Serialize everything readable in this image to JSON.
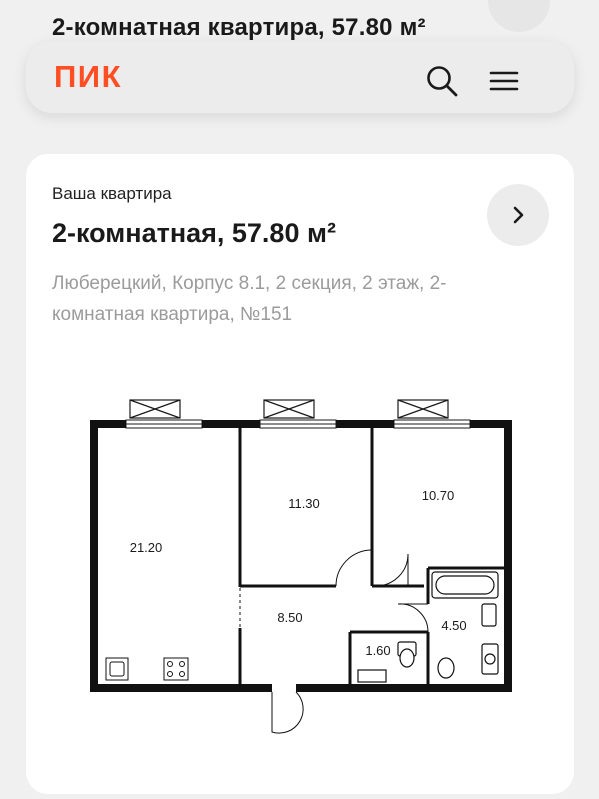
{
  "behind": {
    "title": "2-комнатная квартира, 57.80 м²"
  },
  "header": {
    "logo": "ПИК",
    "brand_color": "#ff4e23",
    "search_icon": "search-icon",
    "menu_icon": "hamburger-menu-icon"
  },
  "card": {
    "label": "Ваша квартира",
    "title": "2-комнатная, 57.80 м²",
    "address": "Люберецкий, Корпус 8.1, 2 секция, 2 этаж, 2-комнатная квартира, №151",
    "arrow_icon": "chevron-right-icon"
  },
  "floorplan": {
    "rooms": [
      {
        "id": "room-1",
        "area": "21.20"
      },
      {
        "id": "room-2",
        "area": "11.30"
      },
      {
        "id": "room-3",
        "area": "10.70"
      },
      {
        "id": "hall",
        "area": "8.50"
      },
      {
        "id": "wc",
        "area": "1.60"
      },
      {
        "id": "bath",
        "area": "4.50"
      }
    ]
  }
}
